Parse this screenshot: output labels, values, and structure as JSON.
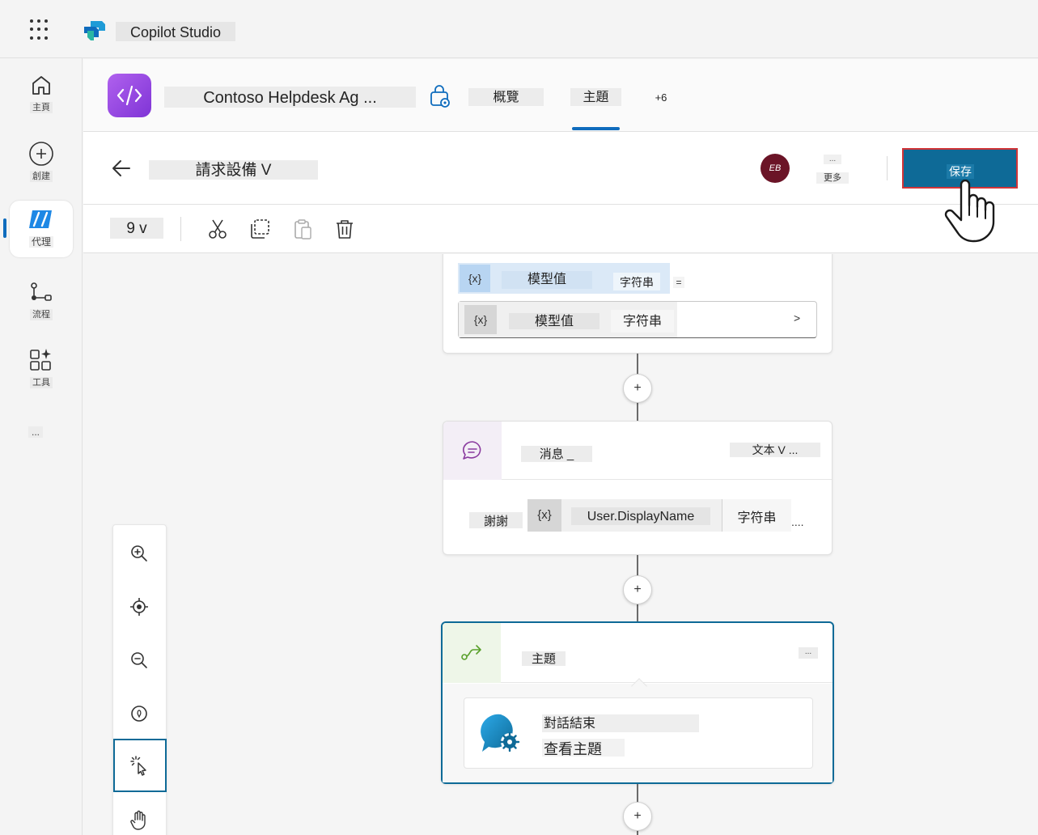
{
  "app": {
    "title": "Copilot Studio"
  },
  "rail": {
    "items": [
      {
        "label": "主頁",
        "icon": "home-icon"
      },
      {
        "label": "創建",
        "icon": "add-circle-icon"
      },
      {
        "label": "代理",
        "icon": "agent-icon",
        "active": true
      },
      {
        "label": "流程",
        "icon": "flow-icon"
      },
      {
        "label": "工具",
        "icon": "tools-icon"
      }
    ],
    "more_label": "..."
  },
  "agent": {
    "name": "Contoso Helpdesk Ag ...",
    "tabs": {
      "overview": "概覽",
      "topics": "主題",
      "more": "+6"
    },
    "active_tab": "topics"
  },
  "topic": {
    "name": "請求設備 V",
    "user_initials": "EB",
    "more_dots": "...",
    "more_label": "更多",
    "save_label": "保存"
  },
  "toolbar": {
    "version": "9 v"
  },
  "nodes": {
    "set_variable": {
      "var_icon": "{x}",
      "var_name": "模型值",
      "var_type": "字符串",
      "equals": "=",
      "value_icon": "{x}",
      "value_name": "模型值",
      "value_type": "字符串",
      "chevron": ">"
    },
    "message": {
      "title": "消息 _",
      "variation": "文本 V ...",
      "text": "謝謝",
      "var_icon": "{x}",
      "var_name": "User.DisplayName",
      "var_type": "字符串",
      "ellipsis": "...."
    },
    "topic_redirect": {
      "title": "主題",
      "more": "...",
      "line1": "對話結束",
      "line2": "查看主題"
    },
    "add_label": "+"
  },
  "colors": {
    "accent": "#0e6a97",
    "highlight_border": "#d13438",
    "user_avatar": "#6b1427",
    "agent_avatar": "#9b4de8"
  }
}
